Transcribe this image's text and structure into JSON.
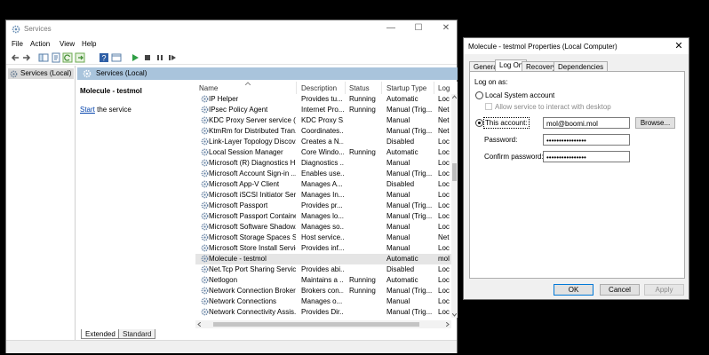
{
  "services_window": {
    "title": "Services",
    "controls": {
      "minimize": "—",
      "maximize": "☐",
      "close": "✕"
    },
    "menu": [
      "File",
      "Action",
      "View",
      "Help"
    ],
    "toolbar_icons": [
      "back-arrow-icon",
      "forward-arrow-icon",
      "show-hide-tree-icon",
      "properties-icon",
      "refresh-icon",
      "export-icon",
      "help-icon",
      "console-view-icon",
      "start-icon",
      "stop-icon",
      "pause-icon",
      "restart-icon"
    ],
    "tree": {
      "item": "Services (Local)"
    },
    "banner": "Services (Local)",
    "detail": {
      "title": "Molecule - testmol",
      "start_link": "Start",
      "start_rest": " the service"
    },
    "columns": [
      "Name",
      "Description",
      "Status",
      "Startup Type",
      "Log"
    ],
    "rows": [
      {
        "name": "IP Helper",
        "description": "Provides tu...",
        "status": "Running",
        "startup": "Automatic",
        "log": "Loc"
      },
      {
        "name": "IPsec Policy Agent",
        "description": "Internet Pro...",
        "status": "Running",
        "startup": "Manual (Trig...",
        "log": "Net"
      },
      {
        "name": "KDC Proxy Server service (K...",
        "description": "KDC Proxy S...",
        "status": "",
        "startup": "Manual",
        "log": "Net"
      },
      {
        "name": "KtmRm for Distributed Tran...",
        "description": "Coordinates...",
        "status": "",
        "startup": "Manual (Trig...",
        "log": "Net"
      },
      {
        "name": "Link-Layer Topology Discov...",
        "description": "Creates a N...",
        "status": "",
        "startup": "Disabled",
        "log": "Loc"
      },
      {
        "name": "Local Session Manager",
        "description": "Core Windo...",
        "status": "Running",
        "startup": "Automatic",
        "log": "Loc"
      },
      {
        "name": "Microsoft (R) Diagnostics H...",
        "description": "Diagnostics ...",
        "status": "",
        "startup": "Manual",
        "log": "Loc"
      },
      {
        "name": "Microsoft Account Sign-in ...",
        "description": "Enables use...",
        "status": "",
        "startup": "Manual (Trig...",
        "log": "Loc"
      },
      {
        "name": "Microsoft App-V Client",
        "description": "Manages A...",
        "status": "",
        "startup": "Disabled",
        "log": "Loc"
      },
      {
        "name": "Microsoft iSCSI Initiator Ser...",
        "description": "Manages In...",
        "status": "",
        "startup": "Manual",
        "log": "Loc"
      },
      {
        "name": "Microsoft Passport",
        "description": "Provides pr...",
        "status": "",
        "startup": "Manual (Trig...",
        "log": "Loc"
      },
      {
        "name": "Microsoft Passport Container",
        "description": "Manages lo...",
        "status": "",
        "startup": "Manual (Trig...",
        "log": "Loc"
      },
      {
        "name": "Microsoft Software Shadow...",
        "description": "Manages so...",
        "status": "",
        "startup": "Manual",
        "log": "Loc"
      },
      {
        "name": "Microsoft Storage Spaces S...",
        "description": "Host service...",
        "status": "",
        "startup": "Manual",
        "log": "Net"
      },
      {
        "name": "Microsoft Store Install Service",
        "description": "Provides inf...",
        "status": "",
        "startup": "Manual",
        "log": "Loc"
      },
      {
        "name": "Molecule - testmol",
        "description": "",
        "status": "",
        "startup": "Automatic",
        "log": "mol",
        "selected": true
      },
      {
        "name": "Net.Tcp Port Sharing Service",
        "description": "Provides abi...",
        "status": "",
        "startup": "Disabled",
        "log": "Loc"
      },
      {
        "name": "Netlogon",
        "description": "Maintains a ...",
        "status": "Running",
        "startup": "Automatic",
        "log": "Loc"
      },
      {
        "name": "Network Connection Broker",
        "description": "Brokers con...",
        "status": "Running",
        "startup": "Manual (Trig...",
        "log": "Loc"
      },
      {
        "name": "Network Connections",
        "description": "Manages o...",
        "status": "",
        "startup": "Manual",
        "log": "Loc"
      },
      {
        "name": "Network Connectivity Assis...",
        "description": "Provides Dir...",
        "status": "",
        "startup": "Manual (Trig...",
        "log": "Loc"
      }
    ],
    "bottom_tabs": [
      "Extended",
      "Standard"
    ]
  },
  "properties_dialog": {
    "title": "Molecule - testmol Properties (Local Computer)",
    "close": "✕",
    "tabs": [
      "General",
      "Log On",
      "Recovery",
      "Dependencies"
    ],
    "active_tab": "Log On",
    "logon_as": "Log on as:",
    "local_system": "Local System account",
    "allow_interact": "Allow service to interact with desktop",
    "this_account": "This account:",
    "account_value": "mol@boomi.mol",
    "browse": "Browse...",
    "password_label": "Password:",
    "password_value": "••••••••••••••••",
    "confirm_label": "Confirm password:",
    "confirm_value": "••••••••••••••••",
    "ok": "OK",
    "cancel": "Cancel",
    "apply": "Apply"
  },
  "colors": {
    "banner": "#a9c4dc",
    "link": "#0645ad",
    "selection": "#e5e5e5",
    "default_button_border": "#0078d7"
  }
}
